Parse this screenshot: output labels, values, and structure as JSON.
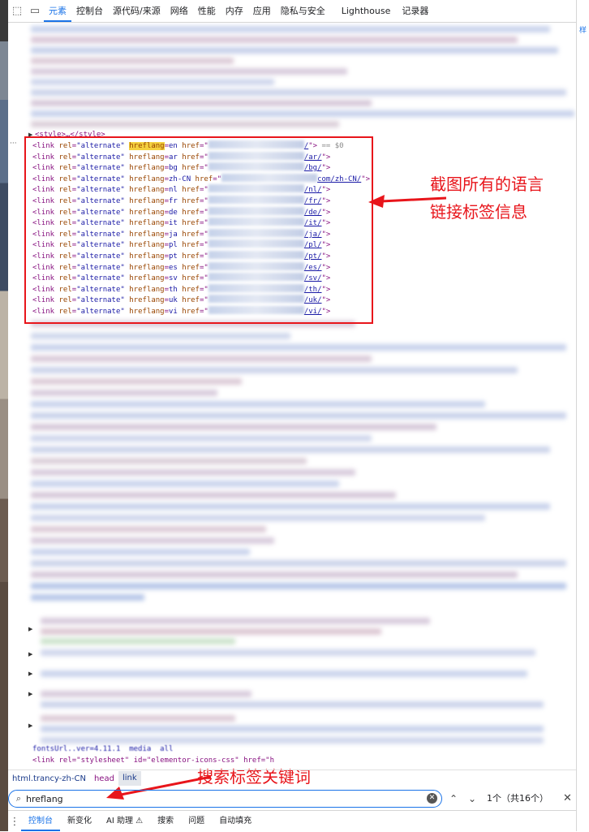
{
  "tabs": {
    "inspect_icon": "cursor-inspect-icon",
    "device_icon": "device-toggle-icon",
    "items": [
      "元素",
      "控制台",
      "源代码/来源",
      "网络",
      "性能",
      "内存",
      "应用",
      "隐私与安全",
      "Lighthouse",
      "记录器"
    ]
  },
  "code": {
    "style_line": "<style>…</style>",
    "eq0": "== $0",
    "links": [
      {
        "hreflang": "en",
        "suffix": "/"
      },
      {
        "hreflang": "ar",
        "suffix": "/ar/"
      },
      {
        "hreflang": "bg",
        "suffix": "/bg/"
      },
      {
        "hreflang": "zh-CN",
        "suffix": "com/zh-CN/"
      },
      {
        "hreflang": "nl",
        "suffix": "/nl/"
      },
      {
        "hreflang": "fr",
        "suffix": "/fr/"
      },
      {
        "hreflang": "de",
        "suffix": "/de/"
      },
      {
        "hreflang": "it",
        "suffix": "/it/"
      },
      {
        "hreflang": "ja",
        "suffix": "/ja/"
      },
      {
        "hreflang": "pl",
        "suffix": "/pl/"
      },
      {
        "hreflang": "pt",
        "suffix": "/pt/"
      },
      {
        "hreflang": "es",
        "suffix": "/es/"
      },
      {
        "hreflang": "sv",
        "suffix": "/sv/"
      },
      {
        "hreflang": "th",
        "suffix": "/th/"
      },
      {
        "hreflang": "uk",
        "suffix": "/uk/"
      },
      {
        "hreflang": "vi",
        "suffix": "/vi/"
      }
    ],
    "bottom_partial": "fontsUrl..ver=4.11.1  media  all",
    "stylesheet_line": "<link rel=\"stylesheet\" id=\"elementor-icons-css\" href=\"h"
  },
  "annotations": {
    "top_line1": "截图所有的语言",
    "top_line2": "链接标签信息",
    "bottom": "搜索标签关键词"
  },
  "breadcrumb": [
    "html.trancy-zh-CN",
    "head",
    "link"
  ],
  "search": {
    "value": "hreflang",
    "match_count": "1个（共16个）",
    "search_icon": "search-icon",
    "up_icon": "chevron-up-icon",
    "down_icon": "chevron-down-icon",
    "close_icon": "close-icon"
  },
  "drawer": {
    "tabs": [
      "控制台",
      "新变化",
      "AI 助理 ⚠",
      "搜索",
      "问题",
      "自动填充"
    ]
  },
  "side_panel": {
    "label": "样"
  },
  "colors": {
    "accent": "#1a73e8",
    "annotation_red": "#e8151b",
    "highlight": "#f4d03f"
  }
}
